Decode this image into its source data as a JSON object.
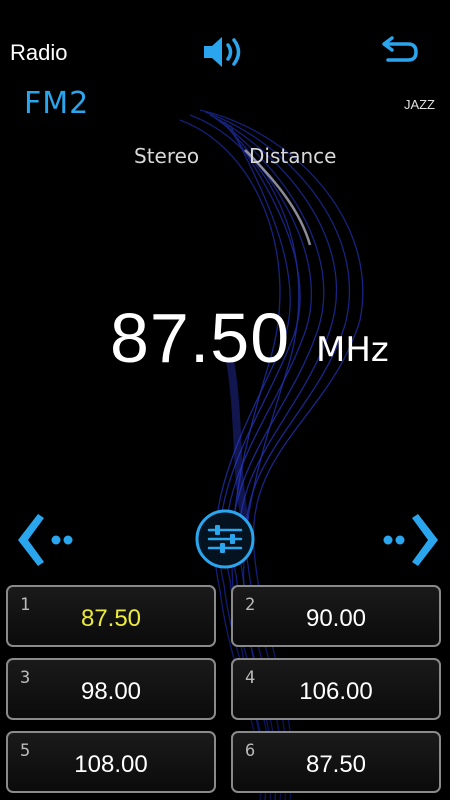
{
  "header": {
    "title": "Radio",
    "volume_icon": "speaker-volume-icon",
    "back_icon": "return-arrow-icon"
  },
  "status": {
    "band": "FM2",
    "genre": "JAZZ",
    "stereo": "Stereo",
    "distance": "Distance"
  },
  "tuner": {
    "frequency": "87.50",
    "unit": "MHz"
  },
  "controls": {
    "prev_icon": "seek-left-icon",
    "eq_icon": "equalizer-sliders-icon",
    "next_icon": "seek-right-icon"
  },
  "presets": [
    {
      "number": "1",
      "freq": "87.50",
      "active": true
    },
    {
      "number": "2",
      "freq": "90.00",
      "active": false
    },
    {
      "number": "3",
      "freq": "98.00",
      "active": false
    },
    {
      "number": "4",
      "freq": "106.00",
      "active": false
    },
    {
      "number": "5",
      "freq": "108.00",
      "active": false
    },
    {
      "number": "6",
      "freq": "87.50",
      "active": false
    }
  ],
  "colors": {
    "accent": "#2aa6ee",
    "active_preset": "#ecea3a",
    "background": "#000000"
  }
}
